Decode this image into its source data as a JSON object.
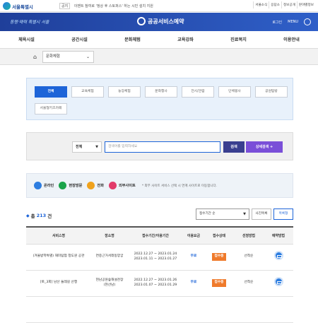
{
  "topbar": {
    "logo": "서울특별시",
    "notice_tag": "공지",
    "notice": "이벤트 참여로 '정상 후 스토퍼스' 하는 시민 설치 지원",
    "util": [
      "서울소식",
      "응답소",
      "정보공개",
      "분야별정보"
    ]
  },
  "header": {
    "slogan": "동행·매력 특별시 서울",
    "brand": "공공서비스예약",
    "login": "로그인",
    "menu": "MENU"
  },
  "nav": [
    "체육시설",
    "공간시설",
    "문화체험",
    "교육강좌",
    "진료복지",
    "이용안내"
  ],
  "breadcrumb": {
    "current": "문화체험"
  },
  "categories": [
    {
      "label": "전체"
    },
    {
      "label": "교육체험"
    },
    {
      "label": "농장체험"
    },
    {
      "label": "문화행사"
    },
    {
      "label": "전시/관람"
    },
    {
      "label": "단체봉사"
    },
    {
      "label": "공원탐방"
    },
    {
      "label": "서울형키즈카페"
    }
  ],
  "search": {
    "scope": "전체",
    "placeholder": "검색어를 입력하세요",
    "button": "검색",
    "detail": "상세검색 +"
  },
  "legend": {
    "items": [
      "온라인",
      "현장방문",
      "전화",
      "외부사이트"
    ],
    "colors": [
      "#2d7de0",
      "#1aa34a",
      "#f0a21c",
      "#e23b6a"
    ],
    "note": "* 외부 사이트 서비스 선택 시 연계 사이트로 이동합니다."
  },
  "list": {
    "total_prefix": "총",
    "total": "213",
    "total_suffix": "건",
    "sort": "접수기간 순",
    "view_photo": "사진목록",
    "view_list": "목록형",
    "columns": [
      "서비스명",
      "장소명",
      "접수기간/이용기간",
      "이용요금",
      "접수상태",
      "선정방법",
      "예약방법"
    ],
    "rows": [
      {
        "name": "(겨울방학특별) 재미탐험 창도원 공관",
        "place": "연중근거서래동양궁",
        "period": "2022.12.27 ~ 2023.01.24\n2023.01.11 ~ 2023.01.27",
        "fee": "무료",
        "status": "접수중",
        "method": "선착순"
      },
      {
        "name": "[토_3회] 남산 둘레길 산행",
        "place": "현남공원숲해설천장\n(현산남)",
        "period": "2022.12.27 ~ 2023.01.26\n2023.01.07 ~ 2023.01.29",
        "fee": "무료",
        "status": "접수중",
        "method": "선착순"
      },
      {
        "name": "",
        "place": "",
        "period": "",
        "fee": "",
        "status": "",
        "method": ""
      }
    ]
  }
}
